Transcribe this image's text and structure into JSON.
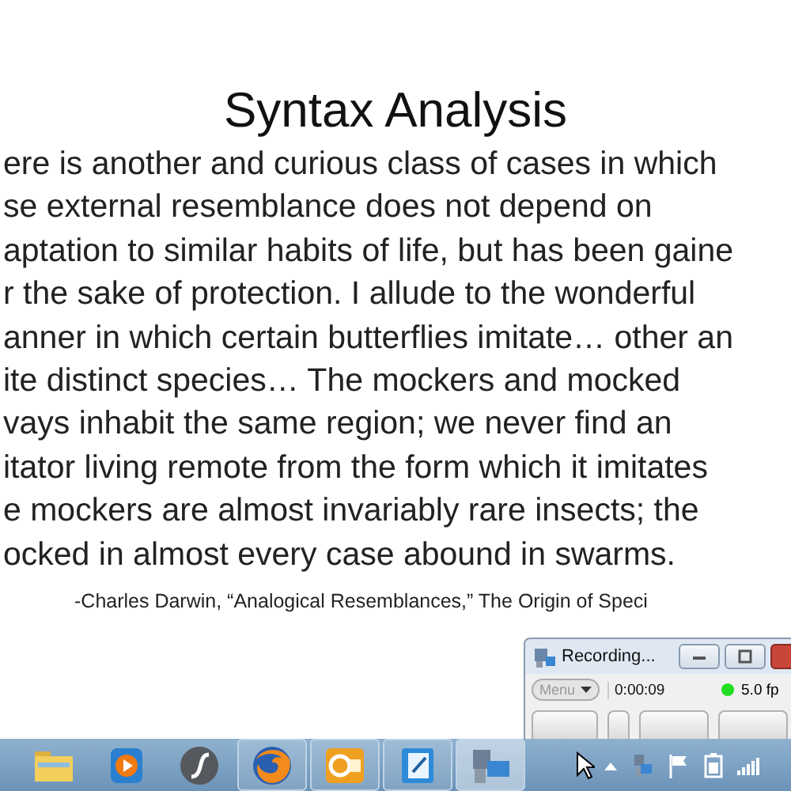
{
  "slide": {
    "title": "Syntax Analysis",
    "lines": [
      "ere is another and curious class of cases in which",
      "se external resemblance does not depend on",
      "aptation to similar habits of life, but has been gaine",
      "r the sake of protection. I allude to the wonderful",
      "anner in which certain butterflies imitate… other an",
      "ite distinct species… The mockers and mocked",
      "vays inhabit the same region; we never find an",
      "itator living remote from the form which it imitates",
      "e mockers are almost invariably rare insects; the",
      "ocked in almost every case abound in swarms."
    ],
    "attribution": "-Charles Darwin, “Analogical Resemblances,” The Origin of Speci"
  },
  "recorder": {
    "title": "Recording...",
    "menu": "Menu",
    "elapsed": "0:00:09",
    "status": {
      "color": "#22dd22"
    },
    "fps": "5.0 fp"
  },
  "taskbar": {
    "apps": [
      {
        "kind": "folder",
        "running": false,
        "selected": false
      },
      {
        "kind": "player",
        "running": false,
        "selected": false
      },
      {
        "kind": "flash",
        "running": false,
        "selected": false
      },
      {
        "kind": "browser",
        "running": true,
        "selected": false
      },
      {
        "kind": "mail",
        "running": true,
        "selected": false
      },
      {
        "kind": "notebook",
        "running": true,
        "selected": false
      },
      {
        "kind": "camcorder",
        "running": true,
        "selected": true
      }
    ]
  }
}
